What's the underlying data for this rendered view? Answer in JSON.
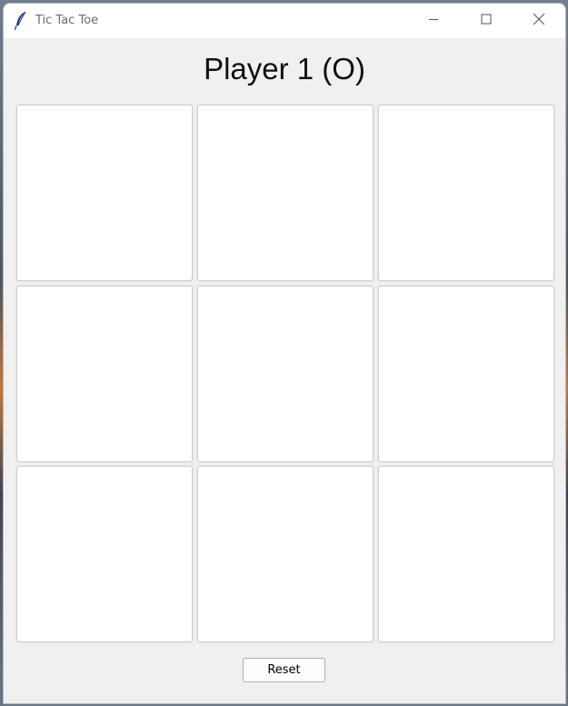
{
  "window": {
    "title": "Tic Tac Toe",
    "app_icon": "feather-icon",
    "controls": {
      "minimize_icon": "minimize-icon",
      "maximize_icon": "maximize-icon",
      "close_icon": "close-icon"
    }
  },
  "game": {
    "status": "Player 1 (O)",
    "board": [
      "",
      "",
      "",
      "",
      "",
      "",
      "",
      "",
      ""
    ],
    "reset_label": "Reset"
  },
  "colors": {
    "window_background": "#f0f0f0",
    "titlebar_background": "#ffffff",
    "cell_background": "#ffffff",
    "cell_border": "#cfcfcf"
  }
}
